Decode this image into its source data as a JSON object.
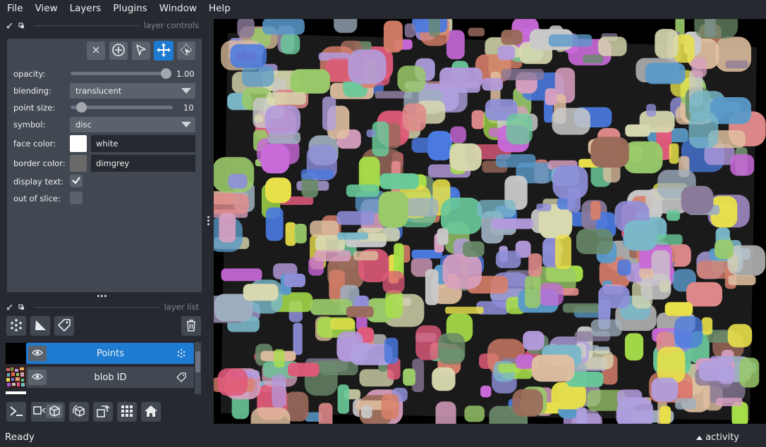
{
  "menubar": {
    "items": [
      "File",
      "View",
      "Layers",
      "Plugins",
      "Window",
      "Help"
    ]
  },
  "dock": {
    "controls_title": "layer controls",
    "list_title": "layer list"
  },
  "controls": {
    "mode_buttons": [
      {
        "icon": "close-icon",
        "active": false
      },
      {
        "icon": "add-point-icon",
        "active": false
      },
      {
        "icon": "select-arrow-icon",
        "active": false
      },
      {
        "icon": "pan-zoom-icon",
        "active": true
      },
      {
        "icon": "transform-icon",
        "active": false
      }
    ],
    "opacity": {
      "label": "opacity:",
      "value": "1.00",
      "fraction": 1.0
    },
    "blending": {
      "label": "blending:",
      "value": "translucent"
    },
    "point_size": {
      "label": "point size:",
      "value": "10",
      "fraction": 0.1
    },
    "symbol": {
      "label": "symbol:",
      "value": "disc"
    },
    "face_color": {
      "label": "face color:",
      "value": "white",
      "swatch": "#ffffff"
    },
    "border_color": {
      "label": "border color:",
      "value": "dimgrey",
      "swatch": "#696969"
    },
    "display_text": {
      "label": "display text:",
      "checked": true
    },
    "out_of_slice": {
      "label": "out of slice:",
      "checked": false
    }
  },
  "layers": [
    {
      "name": "Points",
      "selected": true,
      "type_icon": "points-icon"
    },
    {
      "name": "blob ID",
      "selected": false,
      "type_icon": "label-icon"
    }
  ],
  "layer_tools": [
    "new-points-icon",
    "new-shapes-icon",
    "new-labels-icon",
    "delete-layer-icon"
  ],
  "bottom_buttons": [
    "console-icon",
    "ndisplay-toggle-icon",
    "roll-axes-icon",
    "transpose-icon",
    "grid-icon",
    "home-icon"
  ],
  "status": {
    "text": "Ready",
    "activity": "activity"
  },
  "colors": {
    "background": "#262930",
    "panel": "#414851",
    "accent": "#1d7bd1",
    "canvas": "#000000"
  }
}
